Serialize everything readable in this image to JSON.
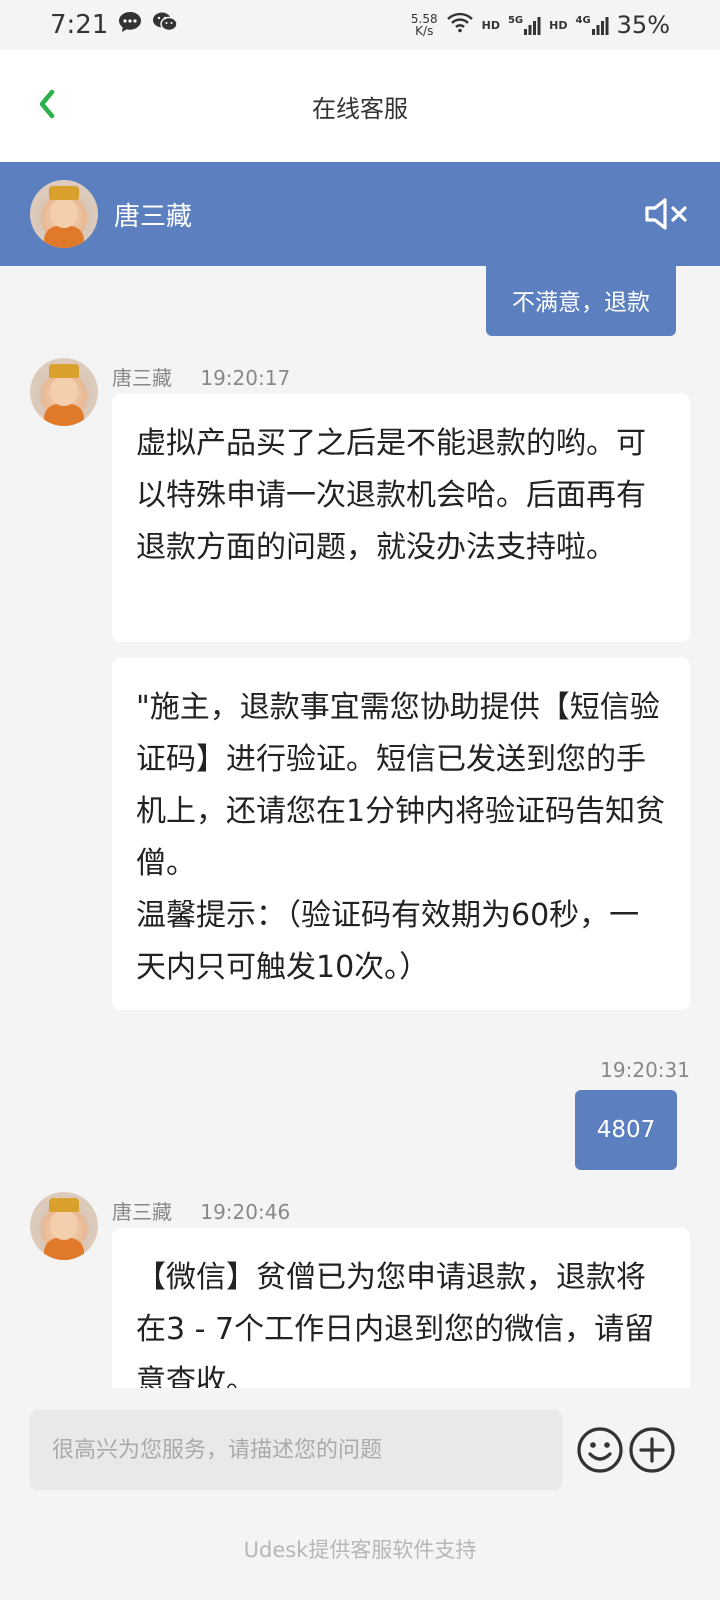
{
  "status": {
    "time": "7:21",
    "net_speed_value": "5.58",
    "net_speed_unit": "K/s",
    "hd1": "HD",
    "sig1": "5G",
    "hd2": "HD",
    "sig2": "4G",
    "battery": "35%"
  },
  "nav": {
    "title": "在线客服"
  },
  "agent": {
    "name": "唐三藏"
  },
  "messages": {
    "out1": "不满意，退款",
    "in1_name": "唐三藏",
    "in1_time": "19:20:17",
    "in1_text": "虚拟产品买了之后是不能退款的哟。可以特殊申请一次退款机会哈。后面再有退款方面的问题，就没办法支持啦。",
    "in2_text": "\"施主，退款事宜需您协助提供【短信验证码】进行验证。短信已发送到您的手机上，还请您在1分钟内将验证码告知贫僧。\n温馨提示：（验证码有效期为60秒，一天内只可触发10次。）",
    "out2_time": "19:20:31",
    "out2": "4807",
    "in3_name": "唐三藏",
    "in3_time": "19:20:46",
    "in3_text": "【微信】贫僧已为您申请退款，退款将在3 - 7个工作日内退到您的微信，请留意查收。"
  },
  "input": {
    "placeholder": "很高兴为您服务，请描述您的问题"
  },
  "footer": {
    "text": "Udesk提供客服软件支持"
  },
  "colors": {
    "accent": "#5c7fbf",
    "back_green": "#2bb24c"
  }
}
